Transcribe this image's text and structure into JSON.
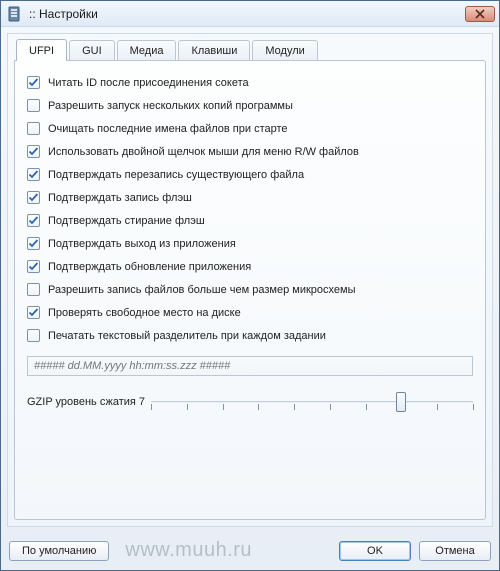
{
  "window": {
    "title": ":: Настройки"
  },
  "tabs": [
    {
      "label": "UFPI",
      "active": true
    },
    {
      "label": "GUI"
    },
    {
      "label": "Медиа"
    },
    {
      "label": "Клавиши"
    },
    {
      "label": "Модули"
    }
  ],
  "options": [
    {
      "checked": true,
      "label": "Читать ID после присоединения сокета"
    },
    {
      "checked": false,
      "label": "Разрешить запуск нескольких копий программы"
    },
    {
      "checked": false,
      "label": "Очищать последние имена файлов при старте"
    },
    {
      "checked": true,
      "label": "Использовать двойной щелчок мыши для меню R/W файлов"
    },
    {
      "checked": true,
      "label": "Подтверждать перезапись существующего файла"
    },
    {
      "checked": true,
      "label": "Подтверждать запись флэш"
    },
    {
      "checked": true,
      "label": "Подтверждать стирание флэш"
    },
    {
      "checked": true,
      "label": "Подтверждать выход из  приложения"
    },
    {
      "checked": true,
      "label": "Подтверждать обновление приложения"
    },
    {
      "checked": false,
      "label": "Разрешить запись файлов больше чем размер микросхемы"
    },
    {
      "checked": true,
      "label": "Проверять свободное место на диске"
    },
    {
      "checked": false,
      "label": "Печатать текстовый разделитель при каждом задании"
    }
  ],
  "separator_field": {
    "placeholder": "##### dd.MM.yyyy hh:mm:ss.zzz #####"
  },
  "slider": {
    "label_prefix": "GZIP уровень сжатия ",
    "value": 7,
    "min": 0,
    "max": 9
  },
  "buttons": {
    "defaults": "По умолчанию",
    "ok": "OK",
    "cancel": "Отмена"
  },
  "watermark": "www.muuh.ru"
}
